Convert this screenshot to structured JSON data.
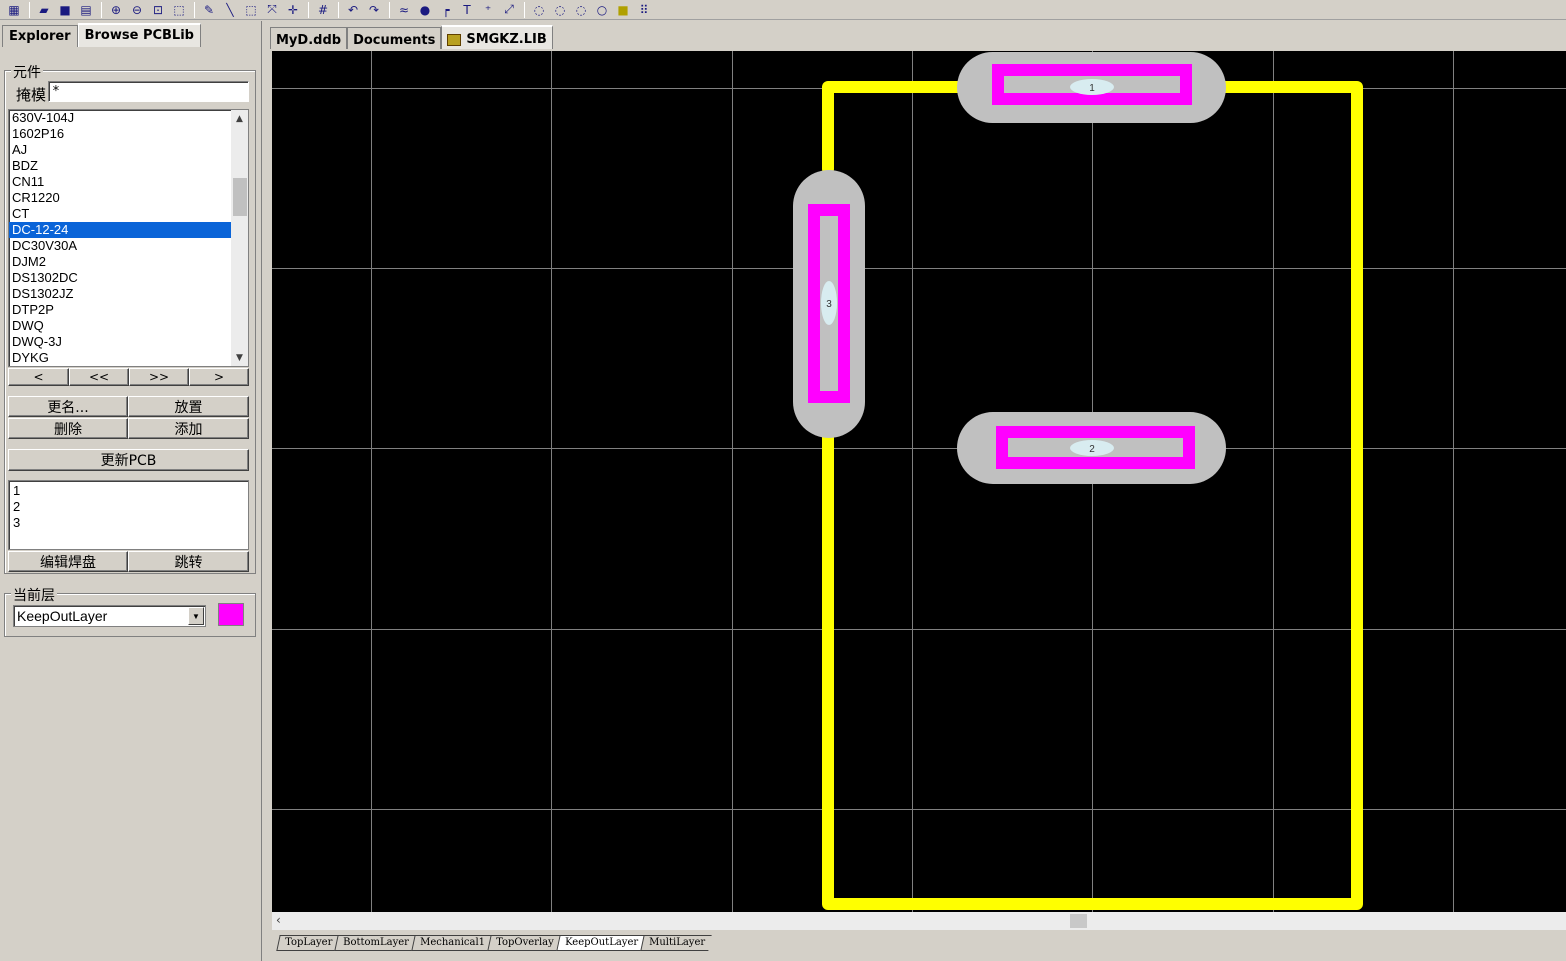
{
  "toolbar": {
    "icons": [
      "project-icon",
      "open-icon",
      "save-icon",
      "print-icon",
      "zoom-in-icon",
      "zoom-out-icon",
      "zoom-fit-icon",
      "zoom-area-icon",
      "wire-icon",
      "line-icon",
      "select-icon",
      "deselect-icon",
      "move-icon",
      "grid-icon",
      "undo-icon",
      "redo-icon",
      "track-icon",
      "pad-icon",
      "via-icon",
      "string-icon",
      "coordinate-icon",
      "dimension-icon",
      "arc-center-icon",
      "arc-edge-icon",
      "arc-any-icon",
      "circle-icon",
      "fill-icon",
      "array-icon"
    ]
  },
  "left_panel": {
    "tabs": [
      {
        "label": "Explorer",
        "active": false
      },
      {
        "label": "Browse PCBLib",
        "active": true
      }
    ],
    "component_group": {
      "title": "元件",
      "mask_label": "掩模",
      "mask_value": "*",
      "list": [
        "630V-104J",
        "1602P16",
        "AJ",
        "BDZ",
        "CN11",
        "CR1220",
        "CT",
        "DC-12-24",
        "DC30V30A",
        "DJM2",
        "DS1302DC",
        "DS1302JZ",
        "DTP2P",
        "DWQ",
        "DWQ-3J",
        "DYKG"
      ],
      "selected": "DC-12-24",
      "nav_buttons": [
        "<",
        "<<",
        ">>",
        ">"
      ],
      "rename_label": "更名...",
      "place_label": "放置",
      "delete_label": "删除",
      "add_label": "添加",
      "update_pcb_label": "更新PCB",
      "pads": [
        "1",
        "2",
        "3"
      ],
      "edit_pad_label": "编辑焊盘",
      "jump_label": "跳转"
    },
    "layer_group": {
      "title": "当前层",
      "current_layer": "KeepOutLayer",
      "layer_color": "#ff00ff"
    }
  },
  "document": {
    "tabs": [
      {
        "label": "MyD.ddb",
        "active": false
      },
      {
        "label": "Documents",
        "active": false
      },
      {
        "label": "SMGKZ.LIB",
        "active": true,
        "icon": "library-icon"
      }
    ],
    "pads": [
      {
        "number": "1"
      },
      {
        "number": "2"
      },
      {
        "number": "3"
      }
    ],
    "colors": {
      "background": "#000000",
      "grid": "#808080",
      "overlay": "#ffff00",
      "keepout": "#ff00ff",
      "multilayer": "#c0c0c0",
      "hole": "#d8ecf0"
    },
    "layer_tabs": [
      "TopLayer",
      "BottomLayer",
      "Mechanical1",
      "TopOverlay",
      "KeepOutLayer",
      "MultiLayer"
    ],
    "active_layer": "KeepOutLayer"
  }
}
